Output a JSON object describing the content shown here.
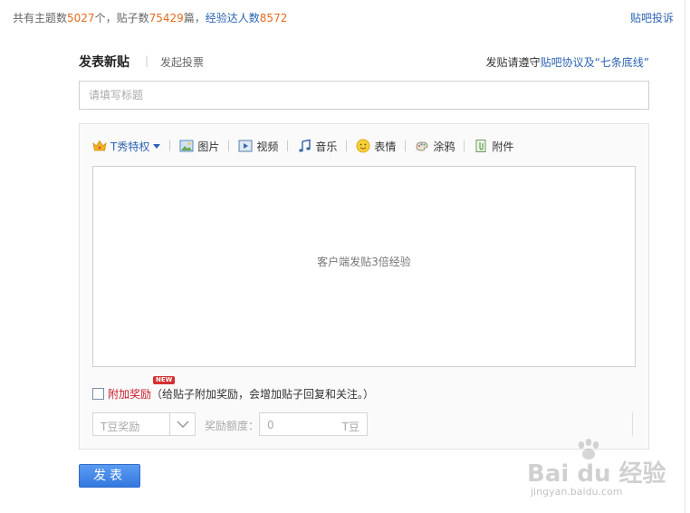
{
  "stats": {
    "topics_prefix": "共有主题数",
    "topics_count": "5027",
    "topics_unit": "个，贴子数",
    "posts_count": "75429",
    "posts_unit": "篇，",
    "experts_label": "经验达人数",
    "experts_count": "8572"
  },
  "header": {
    "complain_link": "贴吧投诉",
    "title": "发表新贴",
    "separator": "|",
    "vote_tab": "发起投票",
    "notice_prefix": "发贴请遵守",
    "notice_link": "贴吧协议及“七条底线”"
  },
  "form": {
    "title_placeholder": "请填写标题",
    "editor_hint": "客户端发贴3倍经验"
  },
  "toolbar": {
    "tshow": "T秀特权",
    "image": "图片",
    "video": "视频",
    "music": "音乐",
    "emoji": "表情",
    "doodle": "涂鸦",
    "attachment": "附件"
  },
  "reward": {
    "label": "附加奖励",
    "badge": "NEW",
    "description": "（给贴子附加奖励，会增加贴子回复和关注。）",
    "select_value": "T豆奖励",
    "amount_label": "奖励额度：",
    "amount_value": "0",
    "amount_unit": "T豆"
  },
  "submit_label": "发表",
  "watermark": {
    "text": "Bai du 经验",
    "url": "jingyan.baidu.com"
  },
  "colors": {
    "link": "#2d64b3",
    "count": "#e56b1f",
    "reward": "#c8202e",
    "button": "#3479e0"
  }
}
